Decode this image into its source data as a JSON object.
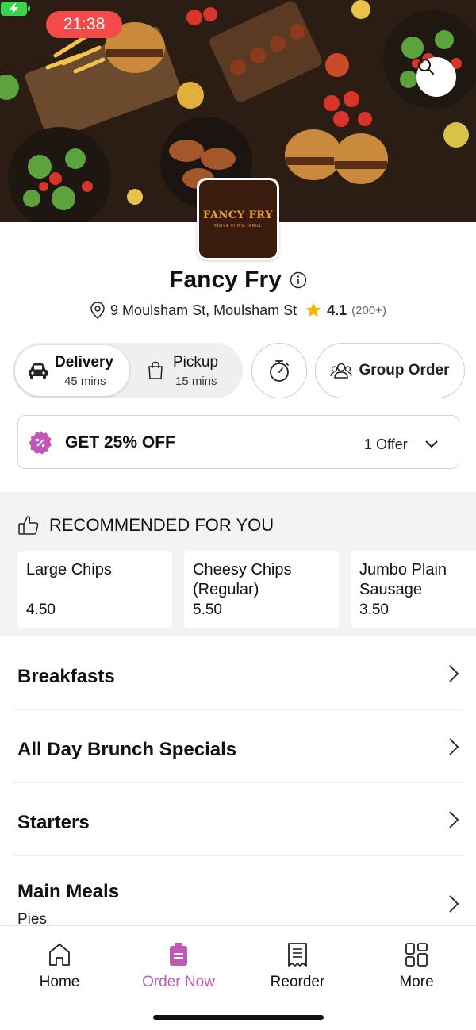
{
  "status_bar": {
    "time": "21:38"
  },
  "store": {
    "logo_title": "FANCY FRY",
    "logo_subtitle": "FISH & CHIPS · GRILL",
    "name": "Fancy Fry",
    "address": "9 Moulsham St, Moulsham St",
    "rating": "4.1",
    "rating_count": "(200+)"
  },
  "order_modes": {
    "delivery": {
      "label": "Delivery",
      "time": "45 mins",
      "selected": true
    },
    "pickup": {
      "label": "Pickup",
      "time": "15 mins",
      "selected": false
    }
  },
  "group_order_label": "Group Order",
  "offer": {
    "title": "GET 25% OFF",
    "count": "1 Offer"
  },
  "recommended": {
    "heading": "RECOMMENDED FOR YOU",
    "items": [
      {
        "name": "Large Chips",
        "price": "4.50"
      },
      {
        "name": "Cheesy Chips (Regular)",
        "price": "5.50"
      },
      {
        "name": "Jumbo Plain Sausage",
        "price": "3.50"
      }
    ]
  },
  "categories": [
    {
      "title": "Breakfasts",
      "subtitle": ""
    },
    {
      "title": "All Day Brunch Specials",
      "subtitle": ""
    },
    {
      "title": "Starters",
      "subtitle": ""
    },
    {
      "title": "Main Meals",
      "subtitle": "Pies"
    }
  ],
  "bottom_nav": [
    {
      "label": "Home",
      "icon": "home-icon",
      "active": false
    },
    {
      "label": "Order Now",
      "icon": "order-bag-icon",
      "active": true
    },
    {
      "label": "Reorder",
      "icon": "receipt-icon",
      "active": false
    },
    {
      "label": "More",
      "icon": "grid-icon",
      "active": false
    }
  ],
  "colors": {
    "accent": "#c058b6",
    "time_pill": "#f24b49",
    "star": "#f5b800",
    "battery": "#3fd24f"
  }
}
